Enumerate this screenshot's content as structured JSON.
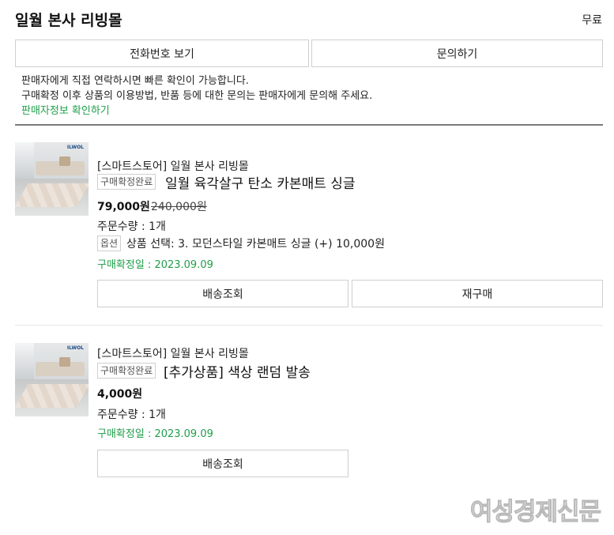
{
  "header": {
    "store_title": "일월 본사 리빙몰",
    "shipping": "무료"
  },
  "actions": {
    "phone_button": "전화번호 보기",
    "inquiry_button": "문의하기"
  },
  "notice": {
    "line1": "판매자에게 직접 연락하시면 빠른 확인이 가능합니다.",
    "line2": "구매확정 이후 상품의 이용방법, 반품 등에 대한 문의는 판매자에게 문의해 주세요.",
    "seller_info_link": "판매자정보 확인하기"
  },
  "orders": [
    {
      "store": "[스마트스토어] 일월 본사 리빙몰",
      "status_badge": "구매확정완료",
      "product_name": "일월 육각살구 탄소 카본매트 싱글",
      "price": "79,000원",
      "original_price": "240,000원",
      "quantity": "주문수량 : 1개",
      "option_badge": "옵션",
      "option_text": "상품 선택: 3. 모던스타일 카본매트 싱글 (+) 10,000원",
      "confirm_date": "구매확정일 : 2023.09.09",
      "tracking_button": "배송조회",
      "reorder_button": "재구매"
    },
    {
      "store": "[스마트스토어] 일월 본사 리빙몰",
      "status_badge": "구매확정완료",
      "product_name": "[추가상품] 색상 랜덤 발송",
      "price": "4,000원",
      "quantity": "주문수량 : 1개",
      "confirm_date": "구매확정일 : 2023.09.09",
      "tracking_button": "배송조회"
    }
  ],
  "watermark": "여성경제신문",
  "colors": {
    "green": "#1f9e4a",
    "border": "#cfcfcf",
    "divider": "#7a7a7a"
  }
}
